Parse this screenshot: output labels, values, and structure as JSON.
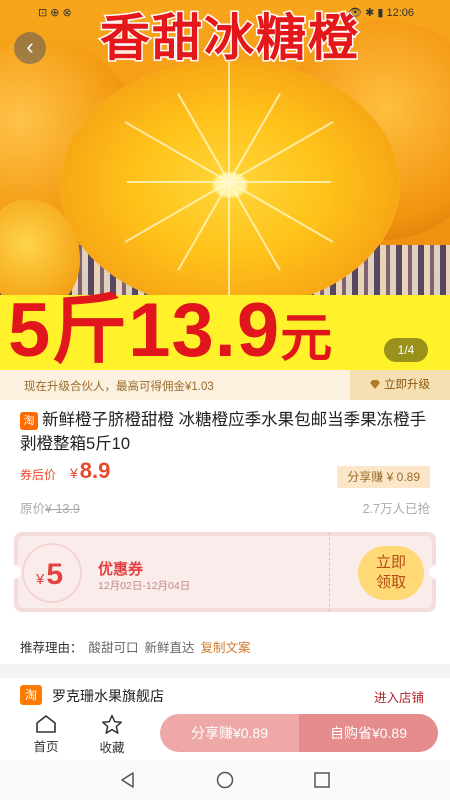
{
  "status_bar": {
    "left": "⊡ ⊕ ⊗",
    "right": "👁 ✱ ▮ 12:06"
  },
  "hero": {
    "banner_title": "香甜冰糖橙",
    "price_amount": "5斤13.9",
    "price_unit": "元",
    "page_indicator": "1/4"
  },
  "partner": {
    "text": "现在升级合伙人，最高可得佣金¥1.03",
    "upgrade_label": "立即升级"
  },
  "product": {
    "badge": "淘",
    "title": "新鲜橙子脐橙甜橙 冰糖橙应季水果包邮当季果冻橙手剥橙整箱5斤10",
    "after_label": "券后价",
    "currency": "¥",
    "after_price": "8.9",
    "share_earn": "分享赚 ¥ 0.89",
    "orig_label": "原价",
    "orig_price": "¥ 13.9",
    "sold": "2.7万人已抢"
  },
  "coupon": {
    "currency": "¥",
    "value": "5",
    "name": "优惠券",
    "date": "12月02日-12月04日",
    "claim_label_line1": "立即",
    "claim_label_line2": "领取"
  },
  "reason": {
    "label": "推荐理由：",
    "items": [
      "酸甜可口",
      "新鲜直达"
    ],
    "copy_label": "复制文案"
  },
  "shop": {
    "icon_text": "淘",
    "name": "罗克珊水果旗舰店",
    "enter_label": "进入店铺"
  },
  "bottom_bar": {
    "home_label": "首页",
    "fav_label": "收藏",
    "share_label": "分享赚¥0.89",
    "buy_label": "自购省¥0.89"
  },
  "colors": {
    "accent_red": "#e4171a",
    "price_red": "#e54a2e",
    "banner_yellow": "#fff22b",
    "cta_pink": "#e58c8c"
  },
  "icons": [
    "back-arrow-icon",
    "diamond-icon",
    "home-icon",
    "star-icon",
    "nav-back-icon",
    "nav-home-icon",
    "nav-recent-icon"
  ]
}
